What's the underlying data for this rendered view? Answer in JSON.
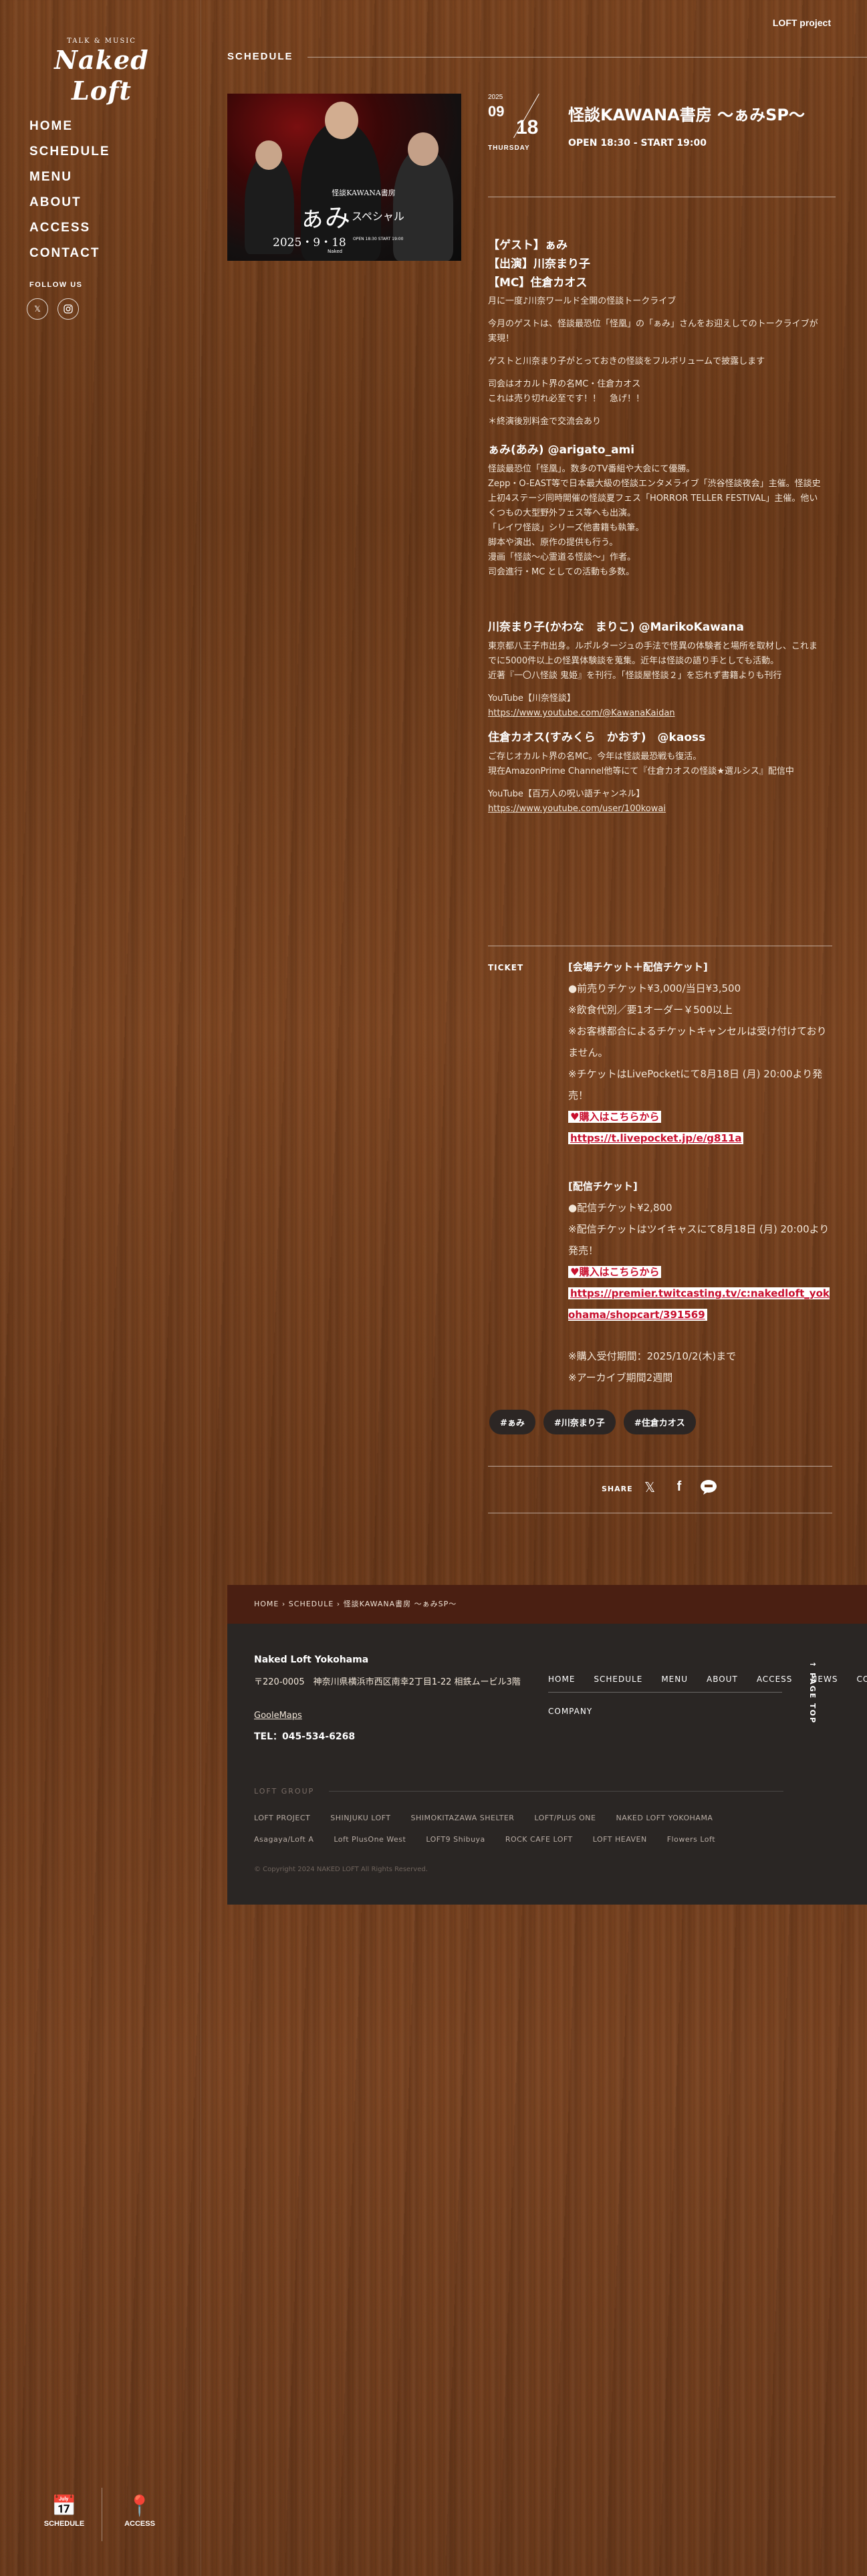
{
  "header": {
    "loft_project": "LOFT project",
    "section": "SCHEDULE"
  },
  "logo": {
    "small": "TALK & MUSIC",
    "main": "Naked Loft"
  },
  "nav": [
    "HOME",
    "SCHEDULE",
    "MENU",
    "ABOUT",
    "ACCESS",
    "CONTACT"
  ],
  "follow": "FOLLOW US",
  "bottom_nav": {
    "schedule": "SCHEDULE",
    "access": "ACCESS"
  },
  "poster": {
    "title": "怪談KAWANA書房",
    "main": "ぁみ",
    "sp": "スペシャル",
    "date": "2025・9・18",
    "open": "OPEN 18:30 START 19:00",
    "sig": "Naked"
  },
  "event": {
    "year": "2025",
    "month": "09",
    "day": "18",
    "dow": "THURSDAY",
    "title": "怪談KAWANA書房 〜ぁみSP〜",
    "time": "OPEN 18:30 - START 19:00"
  },
  "desc": {
    "guest": "【ゲスト】ぁみ",
    "cast": "【出演】川奈まり子",
    "mc": "【MC】住倉カオス",
    "p1": "月に一度♪川奈ワールド全開の怪談トークライブ",
    "p2": "今月のゲストは、怪談最恐位「怪凰」の「ぁみ」さんをお迎えしてのトークライブが実現！",
    "p3": "ゲストと川奈まり子がとっておきの怪談をフルボリュームで披露します",
    "p4a": "司会はオカルト界の名MC・住倉カオス",
    "p4b": "これは売り切れ必至です！！　急げ！！",
    "p5": "＊終演後別料金で交流会あり",
    "ami_name": "ぁみ(あみ) @arigato_ami",
    "ami_lines": [
      "怪談最恐位「怪凰」。数多のTV番組や大会にて優勝。",
      "Zepp・O-EAST等で日本最大級の怪談エンタメライブ「渋谷怪談夜会」主催。怪談史上初4ステージ同時開催の怪談夏フェス「HORROR TELLER FESTIVAL」主催。他いくつもの大型野外フェス等へも出演。",
      "「レイワ怪談」シリーズ他書籍も執筆。",
      "脚本や演出、原作の提供も行う。",
      "漫画「怪談～心霊道る怪談～」作者。",
      "司会進行・MC としての活動も多数。"
    ],
    "kawana_name": "川奈まり子(かわな　まりこ) @MarikoKawana",
    "kawana_lines": [
      "東京都八王子市出身。ルポルタージュの手法で怪異の体験者と場所を取材し、これまでに5000件以上の怪異体験談を蒐集。近年は怪談の語り手としても活動。",
      "近著『一〇八怪談 鬼姫』を刊行。「怪談屋怪談２」を忘れず書籍よりも刊行"
    ],
    "kawana_yt_label": "YouTube【川奈怪談】",
    "kawana_yt_url": "https://www.youtube.com/@KawanaKaidan",
    "chaos_name": "住倉カオス(すみくら　かおす)　@kaoss",
    "chaos_lines": [
      "ご存じオカルト界の名MC。今年は怪談最恐戦も復活。",
      "現在AmazonPrime Channel他等にて『住倉カオスの怪談★選ルシス』配信中"
    ],
    "chaos_yt_label": "YouTube【百万人の呪い語チャンネル】",
    "chaos_yt_url": "https://www.youtube.com/user/100kowai"
  },
  "ticket": {
    "label": "TICKET",
    "venue_head": "[会場チケット＋配信チケット]",
    "venue_lines": [
      "●前売りチケット¥3,000/当日¥3,500",
      "※飲食代別／要1オーダー￥500以上",
      "※お客様都合によるチケットキャンセルは受け付けておりません。",
      "※チケットはLivePocketにて8月18日 (月) 20:00より発売！"
    ],
    "buy": "♥購入はこちらから",
    "venue_url": "https://t.livepocket.jp/e/g811a",
    "stream_head": "[配信チケット]",
    "stream_lines": [
      "●配信チケット¥2,800",
      "※配信チケットはツイキャスにて8月18日 (月) 20:00より発売！"
    ],
    "stream_url": "https://premier.twitcasting.tv/c:nakedloft_yokohama/shopcart/391569",
    "notes": [
      "※購入受付期間：2025/10/2(木)まで",
      "※アーカイブ期間2週間"
    ]
  },
  "tags": [
    "#ぁみ",
    "#川奈まり子",
    "#住倉カオス"
  ],
  "share": "SHARE",
  "breadcrumb": [
    "HOME",
    "SCHEDULE",
    "怪談KAWANA書房 〜ぁみSP〜"
  ],
  "footer": {
    "name": "Naked Loft Yokohama",
    "addr": "〒220-0005　神奈川県横浜市西区南幸2丁目1-22 相鉄ムービル3階",
    "map": "GooleMaps",
    "tel": "TEL：045-534-6268",
    "nav": [
      "HOME",
      "SCHEDULE",
      "MENU",
      "ABOUT",
      "ACCESS",
      "NEWS",
      "CONTACT"
    ],
    "company": "COMPANY",
    "pagetop": "PAGE TOP",
    "group": "LOFT GROUP",
    "links1": [
      "LOFT PROJECT",
      "SHINJUKU LOFT",
      "SHIMOKITAZAWA SHELTER",
      "LOFT/PLUS ONE",
      "NAKED LOFT YOKOHAMA"
    ],
    "links2": [
      "Asagaya/Loft A",
      "Loft PlusOne West",
      "LOFT9 Shibuya",
      "ROCK CAFE LOFT",
      "LOFT HEAVEN",
      "Flowers Loft"
    ],
    "copy": "© Copyright 2024 NAKED LOFT All Rights Reserved."
  }
}
